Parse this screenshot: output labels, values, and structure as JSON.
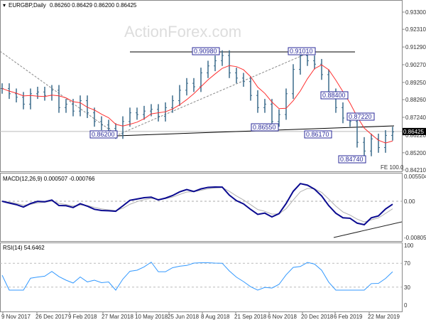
{
  "header": {
    "symbol": "EURGBP,Daily",
    "ohlc": "0.86260 0.86429 0.86200 0.86425"
  },
  "watermark": "ActionForex.com",
  "fe_label": "FE 100.0",
  "macd": {
    "title": "MACD(12,26,9) 0.000507 -0.000766",
    "ticks": [
      "0.005504",
      "0.00",
      "-0.00805"
    ]
  },
  "rsi": {
    "title": "RSI(14) 54.6462",
    "ticks": [
      "100",
      "70",
      "30",
      "0"
    ]
  },
  "colors": {
    "bars": "#3a6a8a",
    "ma": "#ff3030",
    "macd": "#0a0a90",
    "signal": "#b0b0b0",
    "rsi": "#3399ff",
    "label": "#2a2a9a"
  },
  "chart_data": {
    "type": "line",
    "title": "EURGBP,Daily",
    "price_ticks": [
      "0.93300",
      "0.92310",
      "0.91290",
      "0.90270",
      "0.89250",
      "0.88260",
      "0.87240",
      "0.86220",
      "0.85200",
      "0.84210"
    ],
    "ylim": [
      0.8421,
      0.933
    ],
    "current_price": "0.86425",
    "date_ticks": [
      "9 Nov 2017",
      "26 Dec 2017",
      "9 Feb 2018",
      "27 Mar 2018",
      "10 May 2018",
      "25 Jun 2018",
      "8 Aug 2018",
      "21 Sep 2018",
      "6 Nov 2018",
      "20 Dec 2018",
      "6 Feb 2019",
      "22 Mar 2019"
    ],
    "closes": [
      0.889,
      0.886,
      0.884,
      0.88,
      0.886,
      0.887,
      0.885,
      0.888,
      0.878,
      0.88,
      0.876,
      0.882,
      0.875,
      0.87,
      0.868,
      0.866,
      0.863,
      0.87,
      0.875,
      0.874,
      0.876,
      0.877,
      0.873,
      0.878,
      0.882,
      0.888,
      0.892,
      0.89,
      0.898,
      0.902,
      0.905,
      0.908,
      0.898,
      0.895,
      0.893,
      0.885,
      0.878,
      0.88,
      0.87,
      0.874,
      0.886,
      0.9,
      0.908,
      0.905,
      0.903,
      0.897,
      0.886,
      0.878,
      0.872,
      0.87,
      0.858,
      0.853,
      0.86,
      0.855,
      0.862,
      0.864
    ],
    "levels": [
      "0.90980",
      "0.91010",
      "0.88400",
      "0.87220",
      "0.86200",
      "0.86550",
      "0.86170",
      "0.84740"
    ]
  }
}
